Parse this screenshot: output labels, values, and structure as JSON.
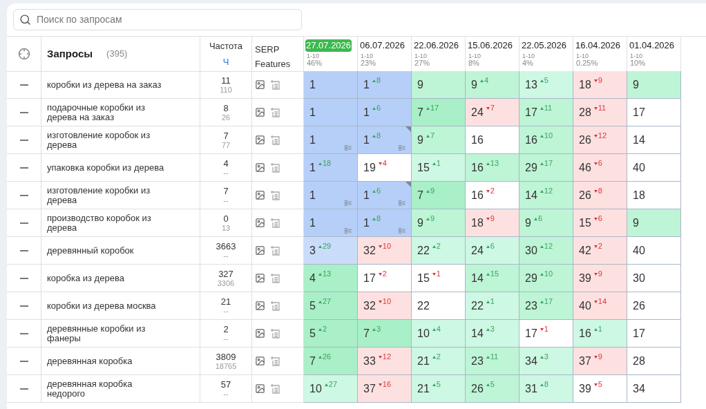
{
  "search": {
    "placeholder": "Поиск по запросам"
  },
  "header": {
    "queries_label": "Запросы",
    "queries_count": "(395)",
    "frequency_label": "Частота",
    "frequency_sub": "Ч",
    "serp_label": "SERP Features"
  },
  "dates": [
    {
      "date": "27.07.2026",
      "range": "1-10",
      "share": "46%",
      "selected": true
    },
    {
      "date": "06.07.2026",
      "range": "1-10",
      "share": "23%",
      "selected": false
    },
    {
      "date": "22.06.2026",
      "range": "1-10",
      "share": "27%",
      "selected": false
    },
    {
      "date": "15.06.2026",
      "range": "1-10",
      "share": "8%",
      "selected": false
    },
    {
      "date": "22.05.2026",
      "range": "1-10",
      "share": "4%",
      "selected": false
    },
    {
      "date": "16.04.2026",
      "range": "1-10",
      "share": "0.25%",
      "selected": false
    },
    {
      "date": "01.04.2026",
      "range": "1-10",
      "share": "10%",
      "selected": false
    }
  ],
  "rows": [
    {
      "query": "коробки из дерева на заказ",
      "freq": "11",
      "freq_exact": "110",
      "cells": [
        {
          "v": "1",
          "color": "#b5cff8",
          "corner": false,
          "list": false
        },
        {
          "v": "1",
          "delta": "8",
          "improved": true,
          "color": "#b5cff8",
          "corner": false,
          "list": false
        },
        {
          "v": "9",
          "color": "#bdf5d6",
          "corner": false,
          "list": false
        },
        {
          "v": "9",
          "delta": "4",
          "improved": true,
          "color": "#bdf5d6",
          "corner": false,
          "list": false
        },
        {
          "v": "13",
          "delta": "5",
          "improved": true,
          "color": "#cdf8e3",
          "corner": false,
          "list": false
        },
        {
          "v": "18",
          "delta": "9",
          "improved": false,
          "color": "#fde1e0",
          "corner": false,
          "list": false
        },
        {
          "v": "9",
          "color": "#bdf5d6",
          "corner": false,
          "list": false
        }
      ]
    },
    {
      "query": "подарочные коробки из дерева на заказ",
      "freq": "8",
      "freq_exact": "26",
      "cells": [
        {
          "v": "1",
          "color": "#b5cff8",
          "corner": false,
          "list": false
        },
        {
          "v": "1",
          "delta": "6",
          "improved": true,
          "color": "#b5cff8",
          "corner": false,
          "list": false
        },
        {
          "v": "7",
          "delta": "17",
          "improved": true,
          "color": "#a9efc7",
          "corner": false,
          "list": false
        },
        {
          "v": "24",
          "delta": "7",
          "improved": false,
          "color": "#fde1e0",
          "corner": false,
          "list": false
        },
        {
          "v": "17",
          "delta": "11",
          "improved": true,
          "color": "#bdf5d6",
          "corner": false,
          "list": false
        },
        {
          "v": "28",
          "delta": "11",
          "improved": false,
          "color": "#fde1e0",
          "corner": false,
          "list": false
        },
        {
          "v": "17",
          "color": "#ffffff",
          "corner": false,
          "list": false
        }
      ]
    },
    {
      "query": "изготовление коробок из дерева",
      "freq": "7",
      "freq_exact": "77",
      "cells": [
        {
          "v": "1",
          "color": "#b5cff8",
          "corner": false,
          "list": true
        },
        {
          "v": "1",
          "delta": "8",
          "improved": true,
          "color": "#b5cff8",
          "corner": true,
          "list": true
        },
        {
          "v": "9",
          "delta": "7",
          "improved": true,
          "color": "#bdf5d6",
          "corner": false,
          "list": false
        },
        {
          "v": "16",
          "color": "#ffffff",
          "corner": false,
          "list": false
        },
        {
          "v": "16",
          "delta": "10",
          "improved": true,
          "color": "#bdf5d6",
          "corner": false,
          "list": false
        },
        {
          "v": "26",
          "delta": "12",
          "improved": false,
          "color": "#fde1e0",
          "corner": false,
          "list": false
        },
        {
          "v": "14",
          "color": "#ffffff",
          "corner": false,
          "list": false
        }
      ]
    },
    {
      "query": "упаковка коробки из дерева",
      "freq": "4",
      "freq_exact": "--",
      "cells": [
        {
          "v": "1",
          "delta": "18",
          "improved": true,
          "color": "#b5cff8",
          "corner": false,
          "list": false
        },
        {
          "v": "19",
          "delta": "4",
          "improved": false,
          "color": "#ffffff",
          "corner": false,
          "list": false
        },
        {
          "v": "15",
          "delta": "1",
          "improved": true,
          "color": "#cdf8e3",
          "corner": false,
          "list": false
        },
        {
          "v": "16",
          "delta": "13",
          "improved": true,
          "color": "#bdf5d6",
          "corner": false,
          "list": false
        },
        {
          "v": "29",
          "delta": "17",
          "improved": true,
          "color": "#bdf5d6",
          "corner": false,
          "list": false
        },
        {
          "v": "46",
          "delta": "6",
          "improved": false,
          "color": "#fde1e0",
          "corner": false,
          "list": false
        },
        {
          "v": "40",
          "color": "#ffffff",
          "corner": false,
          "list": false
        }
      ]
    },
    {
      "query": "изготовление коробки из дерева",
      "freq": "7",
      "freq_exact": "--",
      "cells": [
        {
          "v": "1",
          "color": "#b5cff8",
          "corner": false,
          "list": true
        },
        {
          "v": "1",
          "delta": "6",
          "improved": true,
          "color": "#b5cff8",
          "corner": true,
          "list": true
        },
        {
          "v": "7",
          "delta": "9",
          "improved": true,
          "color": "#a9efc7",
          "corner": false,
          "list": false
        },
        {
          "v": "16",
          "delta": "2",
          "improved": false,
          "color": "#ffffff",
          "corner": false,
          "list": false
        },
        {
          "v": "14",
          "delta": "12",
          "improved": true,
          "color": "#bdf5d6",
          "corner": false,
          "list": false
        },
        {
          "v": "26",
          "delta": "8",
          "improved": false,
          "color": "#fde1e0",
          "corner": false,
          "list": false
        },
        {
          "v": "18",
          "color": "#ffffff",
          "corner": false,
          "list": false
        }
      ]
    },
    {
      "query": "производство коробок из дерева",
      "freq": "0",
      "freq_exact": "13",
      "cells": [
        {
          "v": "1",
          "color": "#b5cff8",
          "corner": false,
          "list": true
        },
        {
          "v": "1",
          "delta": "8",
          "improved": true,
          "color": "#b5cff8",
          "corner": false,
          "list": true
        },
        {
          "v": "9",
          "delta": "9",
          "improved": true,
          "color": "#bdf5d6",
          "corner": false,
          "list": false
        },
        {
          "v": "18",
          "delta": "9",
          "improved": false,
          "color": "#fde1e0",
          "corner": false,
          "list": false
        },
        {
          "v": "9",
          "delta": "6",
          "improved": true,
          "color": "#bdf5d6",
          "corner": false,
          "list": false
        },
        {
          "v": "15",
          "delta": "6",
          "improved": false,
          "color": "#fde1e0",
          "corner": false,
          "list": false
        },
        {
          "v": "9",
          "color": "#bdf5d6",
          "corner": false,
          "list": false
        }
      ]
    },
    {
      "query": "деревянный коробок",
      "freq": "3663",
      "freq_exact": "--",
      "cells": [
        {
          "v": "3",
          "delta": "29",
          "improved": true,
          "color": "#c9dcfa",
          "corner": false,
          "list": false
        },
        {
          "v": "32",
          "delta": "10",
          "improved": false,
          "color": "#fde1e0",
          "corner": false,
          "list": false
        },
        {
          "v": "22",
          "delta": "2",
          "improved": true,
          "color": "#cdf8e3",
          "corner": false,
          "list": false
        },
        {
          "v": "24",
          "delta": "6",
          "improved": true,
          "color": "#cdf8e3",
          "corner": false,
          "list": false
        },
        {
          "v": "30",
          "delta": "12",
          "improved": true,
          "color": "#bdf5d6",
          "corner": false,
          "list": false
        },
        {
          "v": "42",
          "delta": "2",
          "improved": false,
          "color": "#fde1e0",
          "corner": false,
          "list": false
        },
        {
          "v": "40",
          "color": "#ffffff",
          "corner": false,
          "list": false
        }
      ]
    },
    {
      "query": "коробка из дерева",
      "freq": "327",
      "freq_exact": "3306",
      "cells": [
        {
          "v": "4",
          "delta": "13",
          "improved": true,
          "color": "#a9efc7",
          "corner": false,
          "list": false
        },
        {
          "v": "17",
          "delta": "2",
          "improved": false,
          "color": "#ffffff",
          "corner": false,
          "list": false
        },
        {
          "v": "15",
          "delta": "1",
          "improved": false,
          "color": "#ffffff",
          "corner": false,
          "list": false
        },
        {
          "v": "14",
          "delta": "15",
          "improved": true,
          "color": "#bdf5d6",
          "corner": false,
          "list": false
        },
        {
          "v": "29",
          "delta": "10",
          "improved": true,
          "color": "#bdf5d6",
          "corner": false,
          "list": false
        },
        {
          "v": "39",
          "delta": "9",
          "improved": false,
          "color": "#fde1e0",
          "corner": false,
          "list": false
        },
        {
          "v": "30",
          "color": "#ffffff",
          "corner": false,
          "list": false
        }
      ]
    },
    {
      "query": "коробки из дерева москва",
      "freq": "21",
      "freq_exact": "--",
      "cells": [
        {
          "v": "5",
          "delta": "27",
          "improved": true,
          "color": "#a9efc7",
          "corner": false,
          "list": false
        },
        {
          "v": "32",
          "delta": "10",
          "improved": false,
          "color": "#fde1e0",
          "corner": false,
          "list": false
        },
        {
          "v": "22",
          "color": "#ffffff",
          "corner": false,
          "list": false
        },
        {
          "v": "22",
          "delta": "1",
          "improved": true,
          "color": "#cdf8e3",
          "corner": false,
          "list": false
        },
        {
          "v": "23",
          "delta": "17",
          "improved": true,
          "color": "#bdf5d6",
          "corner": false,
          "list": false
        },
        {
          "v": "40",
          "delta": "14",
          "improved": false,
          "color": "#fde1e0",
          "corner": false,
          "list": false
        },
        {
          "v": "26",
          "color": "#ffffff",
          "corner": false,
          "list": false
        }
      ]
    },
    {
      "query": "деревянные коробки из фанеры",
      "freq": "2",
      "freq_exact": "--",
      "cells": [
        {
          "v": "5",
          "delta": "2",
          "improved": true,
          "color": "#a9efc7",
          "corner": false,
          "list": false
        },
        {
          "v": "7",
          "delta": "3",
          "improved": true,
          "color": "#a9efc7",
          "corner": false,
          "list": false
        },
        {
          "v": "10",
          "delta": "4",
          "improved": true,
          "color": "#cdf8e3",
          "corner": false,
          "list": false
        },
        {
          "v": "14",
          "delta": "3",
          "improved": true,
          "color": "#cdf8e3",
          "corner": false,
          "list": false
        },
        {
          "v": "17",
          "delta": "1",
          "improved": false,
          "color": "#ffffff",
          "corner": false,
          "list": false
        },
        {
          "v": "16",
          "delta": "1",
          "improved": true,
          "color": "#cdf8e3",
          "corner": false,
          "list": false
        },
        {
          "v": "17",
          "color": "#ffffff",
          "corner": false,
          "list": false
        }
      ]
    },
    {
      "query": "деревянная коробка",
      "freq": "3809",
      "freq_exact": "18765",
      "cells": [
        {
          "v": "7",
          "delta": "26",
          "improved": true,
          "color": "#a9efc7",
          "corner": false,
          "list": false
        },
        {
          "v": "33",
          "delta": "12",
          "improved": false,
          "color": "#fde1e0",
          "corner": false,
          "list": false
        },
        {
          "v": "21",
          "delta": "2",
          "improved": true,
          "color": "#cdf8e3",
          "corner": false,
          "list": false
        },
        {
          "v": "23",
          "delta": "11",
          "improved": true,
          "color": "#bdf5d6",
          "corner": false,
          "list": false
        },
        {
          "v": "34",
          "delta": "3",
          "improved": true,
          "color": "#cdf8e3",
          "corner": false,
          "list": false
        },
        {
          "v": "37",
          "delta": "9",
          "improved": false,
          "color": "#fde1e0",
          "corner": false,
          "list": false
        },
        {
          "v": "28",
          "color": "#ffffff",
          "corner": false,
          "list": false
        }
      ]
    },
    {
      "query": "деревянная коробка недорого",
      "freq": "57",
      "freq_exact": "--",
      "cells": [
        {
          "v": "10",
          "delta": "27",
          "improved": true,
          "color": "#cdf8e3",
          "corner": false,
          "list": false
        },
        {
          "v": "37",
          "delta": "16",
          "improved": false,
          "color": "#fde1e0",
          "corner": false,
          "list": false
        },
        {
          "v": "21",
          "delta": "5",
          "improved": true,
          "color": "#cdf8e3",
          "corner": false,
          "list": false
        },
        {
          "v": "26",
          "delta": "5",
          "improved": true,
          "color": "#bdf5d6",
          "corner": false,
          "list": false
        },
        {
          "v": "31",
          "delta": "8",
          "improved": true,
          "color": "#cdf8e3",
          "corner": false,
          "list": false
        },
        {
          "v": "39",
          "delta": "5",
          "improved": false,
          "color": "#ffffff",
          "corner": false,
          "list": false
        },
        {
          "v": "34",
          "color": "#ffffff",
          "corner": false,
          "list": false
        }
      ]
    }
  ]
}
